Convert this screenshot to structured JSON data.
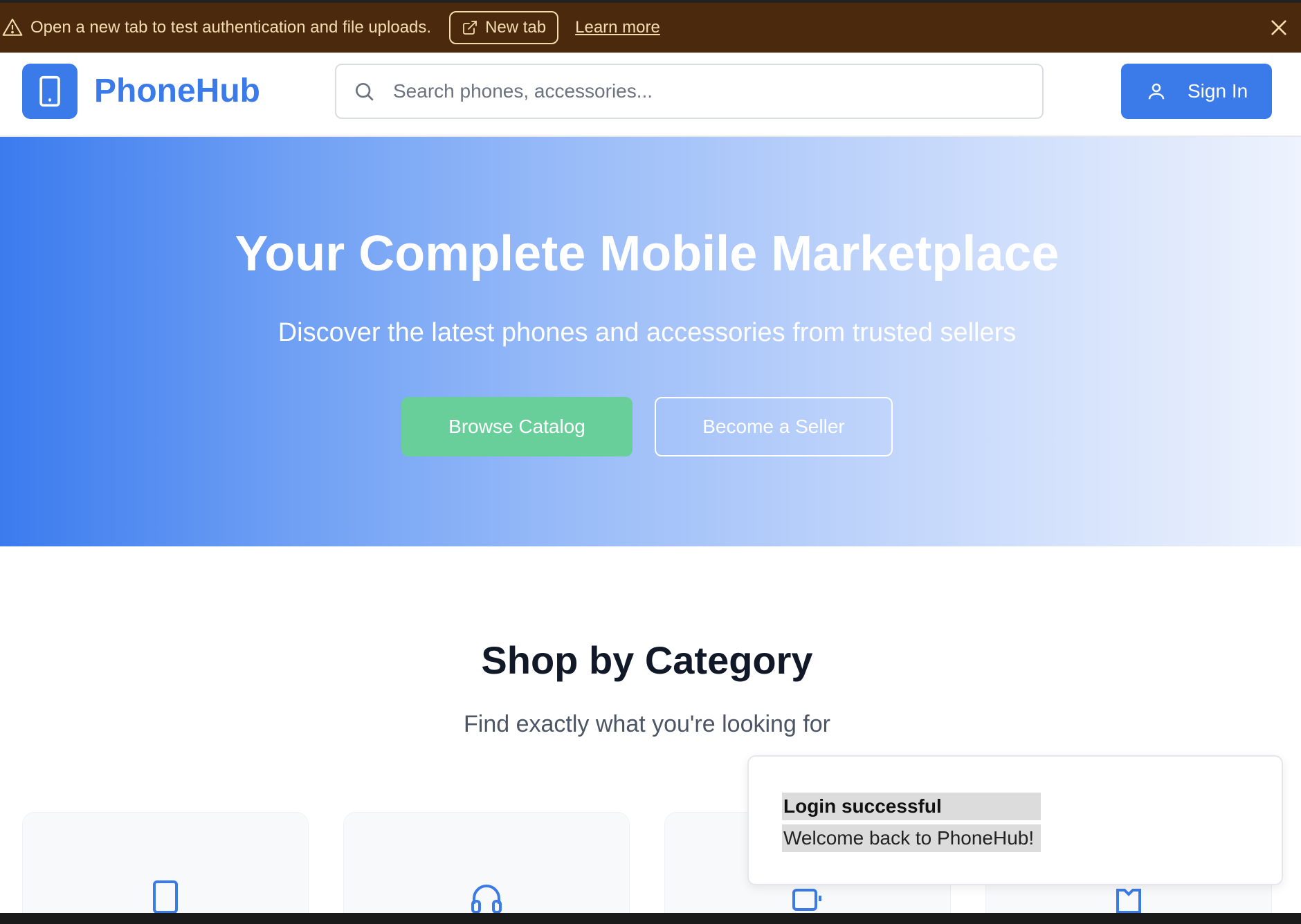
{
  "banner": {
    "message": "Open a new tab to test authentication and file uploads.",
    "new_tab_label": "New tab",
    "learn_more_label": "Learn more",
    "background": "#4a290d",
    "text_color": "#f4dcb0"
  },
  "header": {
    "brand": "PhoneHub",
    "search_placeholder": "Search phones, accessories...",
    "sign_in_label": "Sign In",
    "accent": "#3b7be9"
  },
  "hero": {
    "title": "Your Complete Mobile Marketplace",
    "subtitle": "Discover the latest phones and accessories from trusted sellers",
    "browse_label": "Browse Catalog",
    "seller_label": "Become a Seller",
    "browse_color": "#69cf9a"
  },
  "categories": {
    "title": "Shop by Category",
    "subtitle": "Find exactly what you're looking for",
    "cards": [
      {
        "icon": "smartphone-icon"
      },
      {
        "icon": "headphones-icon"
      },
      {
        "icon": "charger-icon"
      },
      {
        "icon": "case-icon"
      }
    ]
  },
  "toast": {
    "title": "Login successful",
    "description": "Welcome back to PhoneHub!"
  }
}
